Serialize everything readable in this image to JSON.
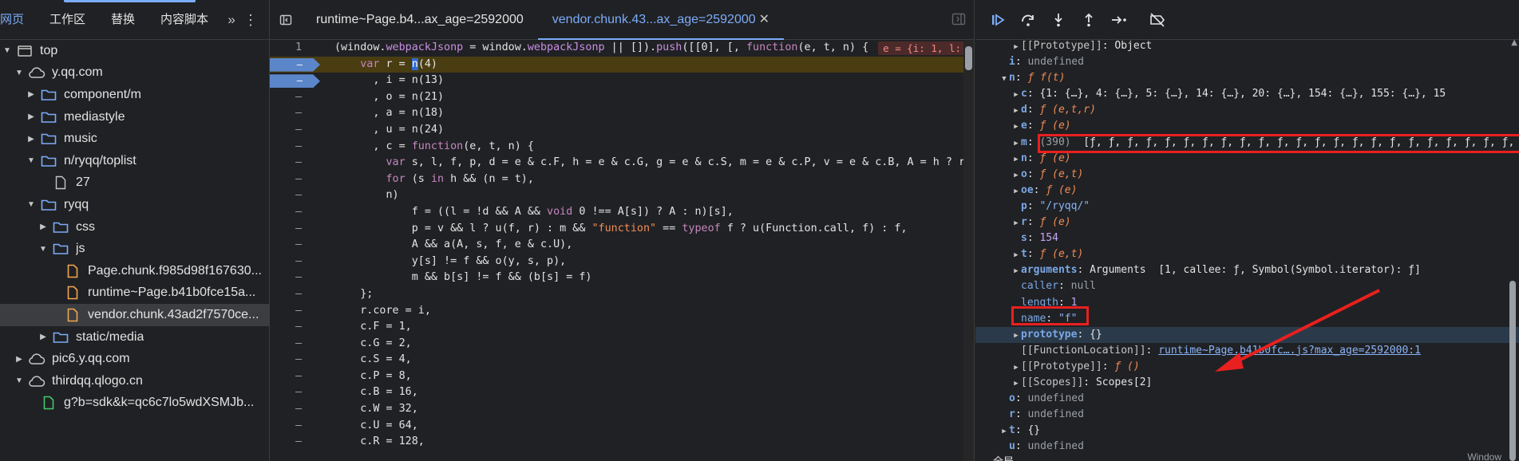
{
  "left_panel": {
    "tabs": [
      {
        "label": "网页",
        "active": true
      },
      {
        "label": "工作区",
        "active": false
      },
      {
        "label": "替换",
        "active": false
      },
      {
        "label": "内容脚本",
        "active": false
      }
    ],
    "more_label": "»",
    "menu_icon": "kebab-icon",
    "tree": [
      {
        "indent": 0,
        "arrow": "open",
        "icon": "frame",
        "label": "top",
        "selected": false
      },
      {
        "indent": 1,
        "arrow": "open",
        "icon": "cloud",
        "label": "y.qq.com",
        "selected": false
      },
      {
        "indent": 2,
        "arrow": "closed",
        "icon": "folder",
        "label": "component/m",
        "selected": false
      },
      {
        "indent": 2,
        "arrow": "closed",
        "icon": "folder",
        "label": "mediastyle",
        "selected": false
      },
      {
        "indent": 2,
        "arrow": "closed",
        "icon": "folder",
        "label": "music",
        "selected": false
      },
      {
        "indent": 2,
        "arrow": "open",
        "icon": "folder",
        "label": "n/ryqq/toplist",
        "selected": false
      },
      {
        "indent": 3,
        "arrow": "none",
        "icon": "file",
        "label": "27",
        "selected": false
      },
      {
        "indent": 2,
        "arrow": "open",
        "icon": "folder",
        "label": "ryqq",
        "selected": false
      },
      {
        "indent": 3,
        "arrow": "closed",
        "icon": "folder",
        "label": "css",
        "selected": false
      },
      {
        "indent": 3,
        "arrow": "open",
        "icon": "folder",
        "label": "js",
        "selected": false
      },
      {
        "indent": 4,
        "arrow": "none",
        "icon": "jsfile",
        "label": "Page.chunk.f985d98f167630...",
        "selected": false
      },
      {
        "indent": 4,
        "arrow": "none",
        "icon": "jsfile",
        "label": "runtime~Page.b41b0fce15a...",
        "selected": false
      },
      {
        "indent": 4,
        "arrow": "none",
        "icon": "jsfile",
        "label": "vendor.chunk.43ad2f7570ce...",
        "selected": true
      },
      {
        "indent": 3,
        "arrow": "closed",
        "icon": "folder",
        "label": "static/media",
        "selected": false
      },
      {
        "indent": 1,
        "arrow": "closed",
        "icon": "cloud",
        "label": "pic6.y.qq.com",
        "selected": false
      },
      {
        "indent": 1,
        "arrow": "open",
        "icon": "cloud",
        "label": "thirdqq.qlogo.cn",
        "selected": false
      },
      {
        "indent": 2,
        "arrow": "none",
        "icon": "greenfile",
        "label": "g?b=sdk&k=qc6c7lo5wdXSMJb...",
        "selected": false
      }
    ]
  },
  "editor": {
    "tabs": [
      {
        "label": "runtime~Page.b4...ax_age=2592000",
        "active": false,
        "closable": false
      },
      {
        "label": "vendor.chunk.43...ax_age=2592000",
        "active": true,
        "closable": true
      }
    ],
    "close_glyph": "✕",
    "inline_hint": "e = {i: 1, l:",
    "lines": [
      {
        "num": "1",
        "bp": false,
        "hl": false
      },
      {
        "num": "–",
        "bp": true,
        "hl": true
      },
      {
        "num": "–",
        "bp": true,
        "hl": false
      },
      {
        "num": "–",
        "bp": false,
        "hl": false
      },
      {
        "num": "–",
        "bp": false,
        "hl": false
      },
      {
        "num": "–",
        "bp": false,
        "hl": false
      },
      {
        "num": "–",
        "bp": false,
        "hl": false
      },
      {
        "num": "–",
        "bp": false,
        "hl": false
      },
      {
        "num": "–",
        "bp": false,
        "hl": false
      },
      {
        "num": "–",
        "bp": false,
        "hl": false
      },
      {
        "num": "–",
        "bp": false,
        "hl": false
      },
      {
        "num": "–",
        "bp": false,
        "hl": false
      },
      {
        "num": "–",
        "bp": false,
        "hl": false
      },
      {
        "num": "–",
        "bp": false,
        "hl": false
      },
      {
        "num": "–",
        "bp": false,
        "hl": false
      },
      {
        "num": "–",
        "bp": false,
        "hl": false
      },
      {
        "num": "–",
        "bp": false,
        "hl": false
      },
      {
        "num": "–",
        "bp": false,
        "hl": false
      },
      {
        "num": "–",
        "bp": false,
        "hl": false
      },
      {
        "num": "–",
        "bp": false,
        "hl": false
      },
      {
        "num": "–",
        "bp": false,
        "hl": false
      },
      {
        "num": "–",
        "bp": false,
        "hl": false
      },
      {
        "num": "–",
        "bp": false,
        "hl": false
      },
      {
        "num": "–",
        "bp": false,
        "hl": false
      },
      {
        "num": "–",
        "bp": false,
        "hl": false
      },
      {
        "num": "–",
        "bp": false,
        "hl": false
      }
    ],
    "code": [
      "(window.<p>webpackJsonp</p> = window.<p>webpackJsonp</p> || []).<p>push</p>([[0], [, <k>function</k>(e, t, n) {",
      "    <k>var</k> r = <c>n</c>(4)",
      "      , i = n(13)",
      "      , o = n(21)",
      "      , a = n(18)",
      "      , u = n(24)",
      "      , c = <k>function</k>(e, t, n) {",
      "        <k>var</k> s, l, f, p, d = e &amp; c.F, h = e &amp; c.G, g = e &amp; c.S, m = e &amp; c.P, v = e &amp; c.B, A = h ? r",
      "        <k>for</k> (s <k>in</k> h &amp;&amp; (n = t),",
      "        n)",
      "            f = ((l = !d &amp;&amp; A &amp;&amp; <k>void</k> 0 !== A[s]) ? A : n)[s],",
      "            p = v &amp;&amp; l ? u(f, r) : m &amp;&amp; <s>\"function\"</s> == <k>typeof</k> f ? u(Function.call, f) : f,",
      "            A &amp;&amp; a(A, s, f, e &amp; c.U),",
      "            y[s] != f &amp;&amp; o(y, s, p),",
      "            m &amp;&amp; b[s] != f &amp;&amp; (b[s] = f)",
      "    };",
      "    r.core = i,",
      "    c.F = 1,",
      "    c.G = 2,",
      "    c.S = 4,",
      "    c.P = 8,",
      "    c.B = 16,",
      "    c.W = 32,",
      "    c.U = 64,",
      "    c.R = 128,"
    ]
  },
  "debugger": {
    "toolbar_icons": [
      "resume-icon",
      "step-over-icon",
      "step-into-icon",
      "step-out-icon",
      "step-icon",
      "deactivate-breakpoints-icon"
    ],
    "scope": [
      {
        "indent": 2,
        "arrow": "closed",
        "html": "<n>[[Prototype]]</n>: <v>Object</v>"
      },
      {
        "indent": 1,
        "arrow": "none",
        "html": "<b>i</b>: <u>undefined</u>"
      },
      {
        "indent": 1,
        "arrow": "open",
        "html": "<b>n</b>: <f>ƒ f(t)</f>"
      },
      {
        "indent": 2,
        "arrow": "closed",
        "html": "<b>c</b>: <v>{1: {…}, 4: {…}, 5: {…}, 14: {…}, 20: {…}, 154: {…}, 155: {…}, 15</v>"
      },
      {
        "indent": 2,
        "arrow": "closed",
        "html": "<b>d</b>: <f>ƒ (e,t,r)</f>"
      },
      {
        "indent": 2,
        "arrow": "closed",
        "html": "<b>e</b>: <f>ƒ (e)</f>"
      },
      {
        "indent": 2,
        "arrow": "closed",
        "html": "<b>m</b>: <u>(390)</u> <v>&nbsp;[ƒ, ƒ, ƒ, ƒ, ƒ, ƒ, ƒ, ƒ, ƒ, ƒ, ƒ, ƒ, ƒ, ƒ, ƒ, ƒ, ƒ, ƒ, ƒ, ƒ, ƒ, ƒ, ƒ, ƒ,</v>"
      },
      {
        "indent": 2,
        "arrow": "closed",
        "html": "<b>n</b>: <f>ƒ (e)</f>"
      },
      {
        "indent": 2,
        "arrow": "closed",
        "html": "<b>o</b>: <f>ƒ (e,t)</f>"
      },
      {
        "indent": 2,
        "arrow": "closed",
        "html": "<b>oe</b>: <f>ƒ (e)</f>"
      },
      {
        "indent": 2,
        "arrow": "none",
        "html": "<b>p</b>: <s>\"/ryqq/\"</s>"
      },
      {
        "indent": 2,
        "arrow": "closed",
        "html": "<b>r</b>: <f>ƒ (e)</f>"
      },
      {
        "indent": 2,
        "arrow": "none",
        "html": "<b>s</b>: <m>154</m>"
      },
      {
        "indent": 2,
        "arrow": "closed",
        "html": "<b>t</b>: <f>ƒ (e,t)</f>"
      },
      {
        "indent": 2,
        "arrow": "closed",
        "html": "<b>arguments</b>: <v>Arguments &nbsp;[1, callee: ƒ, Symbol(Symbol.iterator): ƒ]</v>"
      },
      {
        "indent": 2,
        "arrow": "none",
        "html": "<d>caller</d>: <u>null</u>"
      },
      {
        "indent": 2,
        "arrow": "none",
        "html": "<d>length</d>: <m>1</m>"
      },
      {
        "indent": 2,
        "arrow": "none",
        "html": "<d>name</d>: <s>\"f\"</s>"
      },
      {
        "indent": 2,
        "arrow": "closed",
        "sel": true,
        "html": "<b>prototype</b>: <v>{}</v>"
      },
      {
        "indent": 2,
        "arrow": "none",
        "html": "<n>[[FunctionLocation]]</n>: <l>runtime~Page.b41b0fc….js?max_age=2592000:1</l>"
      },
      {
        "indent": 2,
        "arrow": "closed",
        "html": "<n>[[Prototype]]</n>: <f>ƒ ()</f>"
      },
      {
        "indent": 2,
        "arrow": "closed",
        "html": "<n>[[Scopes]]</n>: <v>Scopes[2]</v>"
      },
      {
        "indent": 1,
        "arrow": "none",
        "html": "<b>o</b>: <u>undefined</u>"
      },
      {
        "indent": 1,
        "arrow": "none",
        "html": "<b>r</b>: <u>undefined</u>"
      },
      {
        "indent": 1,
        "arrow": "closed",
        "html": "<b>t</b>: <v>{}</v>"
      },
      {
        "indent": 1,
        "arrow": "none",
        "html": "<b>u</b>: <u>undefined</u>"
      },
      {
        "indent": 0,
        "arrow": "closed",
        "html": "<v>全局</v>"
      }
    ],
    "window_label": "Window"
  },
  "colors": {
    "accent": "#7cacf8",
    "annotation_red": "#e8201f",
    "breakpoint": "#5b86c9",
    "paused_line": "#4a3d12"
  },
  "annotation": {
    "arrow_color": "#e8201f",
    "boxes": [
      "m-property-box",
      "name-property-box"
    ]
  }
}
